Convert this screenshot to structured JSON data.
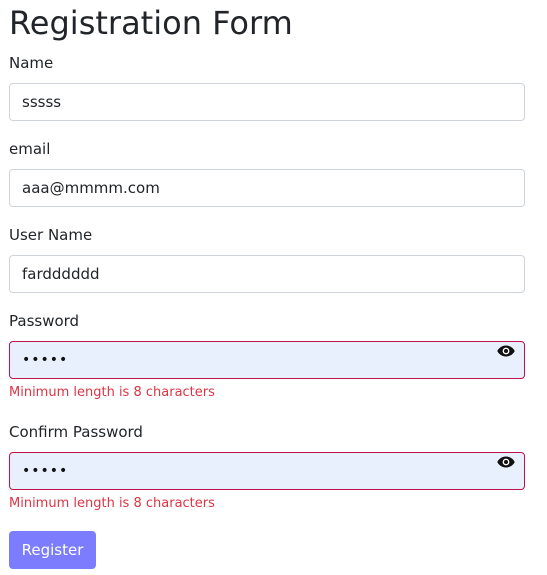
{
  "form": {
    "title": "Registration Form",
    "fields": [
      {
        "label": "Name",
        "value": "sssss"
      },
      {
        "label": "email",
        "value": "aaa@mmmm.com"
      },
      {
        "label": "User Name",
        "value": "fardddddd"
      },
      {
        "label": "Password",
        "value": "•••••",
        "error": "Minimum length is 8 characters",
        "icon": "eye-icon"
      },
      {
        "label": "Confirm Password",
        "value": "•••••",
        "error": "Minimum length is 8 characters",
        "icon": "eye-icon"
      }
    ],
    "submit_label": "Register",
    "colors": {
      "error": "#dc3545",
      "invalid_border": "#c0124a",
      "invalid_background": "#e8f0fe",
      "button": "#7c7cff"
    }
  }
}
